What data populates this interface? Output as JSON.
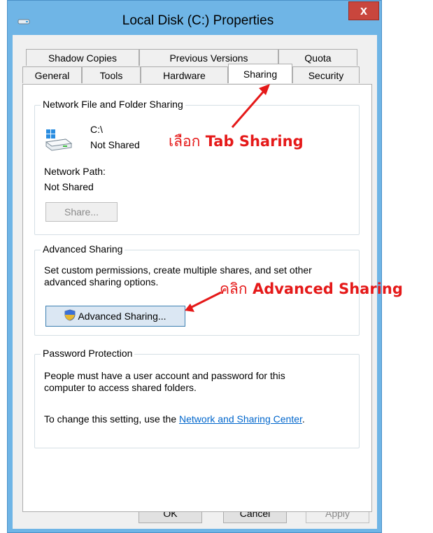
{
  "window": {
    "title": "Local Disk (C:) Properties",
    "close_label": "x"
  },
  "tabs": {
    "row1": [
      "Shadow Copies",
      "Previous Versions",
      "Quota"
    ],
    "row2": [
      "General",
      "Tools",
      "Hardware",
      "Sharing",
      "Security"
    ],
    "active": "Sharing"
  },
  "network_sharing": {
    "legend": "Network File and Folder Sharing",
    "drive_name": "C:\\",
    "drive_status": "Not Shared",
    "network_path_label": "Network Path:",
    "network_path_value": "Not Shared",
    "share_button": "Share..."
  },
  "advanced_sharing": {
    "legend": "Advanced Sharing",
    "description": "Set custom permissions, create multiple shares, and set other advanced sharing options.",
    "button": "Advanced Sharing..."
  },
  "password_protection": {
    "legend": "Password Protection",
    "description": "People must have a user account and password for this computer to access shared folders.",
    "change_text": "To change this setting, use the",
    "link": "Network and Sharing Center",
    "period": "."
  },
  "footer": {
    "ok": "OK",
    "cancel": "Cancel",
    "apply": "Apply"
  },
  "annotations": {
    "tab_thai": "เลือก",
    "tab_en": "Tab Sharing",
    "adv_thai": "คลิก",
    "adv_en": "Advanced Sharing"
  },
  "colors": {
    "annotation": "#e51919",
    "title_bar": "#6fb5e6",
    "close_button": "#c9463d",
    "link": "#0066cc"
  }
}
